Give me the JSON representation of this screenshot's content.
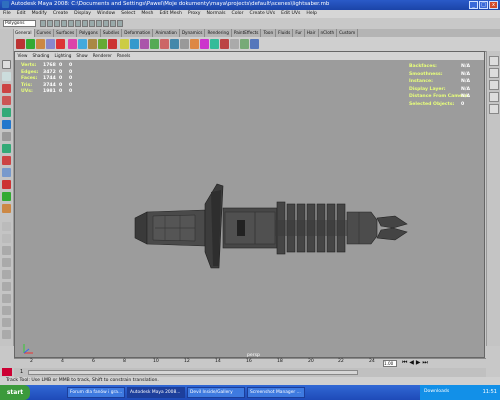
{
  "window": {
    "title": "Autodesk Maya 2008: C:\\Documents and Settings\\Pawel\\Moje dokumenty\\maya\\projects\\default\\scenes\\lightsaber.mb",
    "min": "_",
    "max": "□",
    "close": "x"
  },
  "menus": [
    "File",
    "Edit",
    "Modify",
    "Create",
    "Display",
    "Window",
    "Select",
    "Mesh",
    "Edit Mesh",
    "Proxy",
    "Normals",
    "Color",
    "Create UVs",
    "Edit UVs",
    "Help"
  ],
  "status_line": {
    "mode": "Polygons"
  },
  "shelf_tabs": [
    "General",
    "Curves",
    "Surfaces",
    "Polygons",
    "Subdivs",
    "Deformation",
    "Animation",
    "Dynamics",
    "Rendering",
    "PaintEffects",
    "Toon",
    "Fluids",
    "Fur",
    "Hair",
    "nCloth",
    "Custom"
  ],
  "panel_menu": [
    "View",
    "Shading",
    "Lighting",
    "Show",
    "Renderer",
    "Panels"
  ],
  "hud_left": [
    {
      "label": "Verts:",
      "v1": "1768",
      "v2": "0",
      "v3": "0"
    },
    {
      "label": "Edges:",
      "v1": "3472",
      "v2": "0",
      "v3": "0"
    },
    {
      "label": "Faces:",
      "v1": "1744",
      "v2": "0",
      "v3": "0"
    },
    {
      "label": "Tris:",
      "v1": "3744",
      "v2": "0",
      "v3": "0"
    },
    {
      "label": "UVs:",
      "v1": "1981",
      "v2": "0",
      "v3": "0"
    }
  ],
  "hud_right": [
    {
      "label": "Backfaces:",
      "value": "N/A"
    },
    {
      "label": "Smoothness:",
      "value": "N/A"
    },
    {
      "label": "Instance:",
      "value": "N/A"
    },
    {
      "label": "Display Layer:",
      "value": "N/A"
    },
    {
      "label": "Distance From Camera:",
      "value": "N/A"
    },
    {
      "label": "Selected Objects:",
      "value": "0"
    }
  ],
  "camera": "persp",
  "timeline": {
    "ticks": [
      "2",
      "4",
      "6",
      "8",
      "10",
      "12",
      "14",
      "16",
      "18",
      "20",
      "22",
      "24"
    ],
    "current": "1.00"
  },
  "range": {
    "start": "1"
  },
  "help_line": "Track Tool: Use LMB or MMB to track, Shift to constrain translation.",
  "taskbar": {
    "start": "start",
    "tasks": [
      "Forum dla fanów i gra...",
      "Autodesk Maya 2008...",
      "Devil Inside/Gallery",
      "Screenshot Manager ..."
    ],
    "tray_label": "Downloads",
    "clock": "11:51"
  },
  "colors": {
    "viewport": "#9c9c9c",
    "hud_label": "#e8ff7a",
    "title": "#1b44a8"
  }
}
